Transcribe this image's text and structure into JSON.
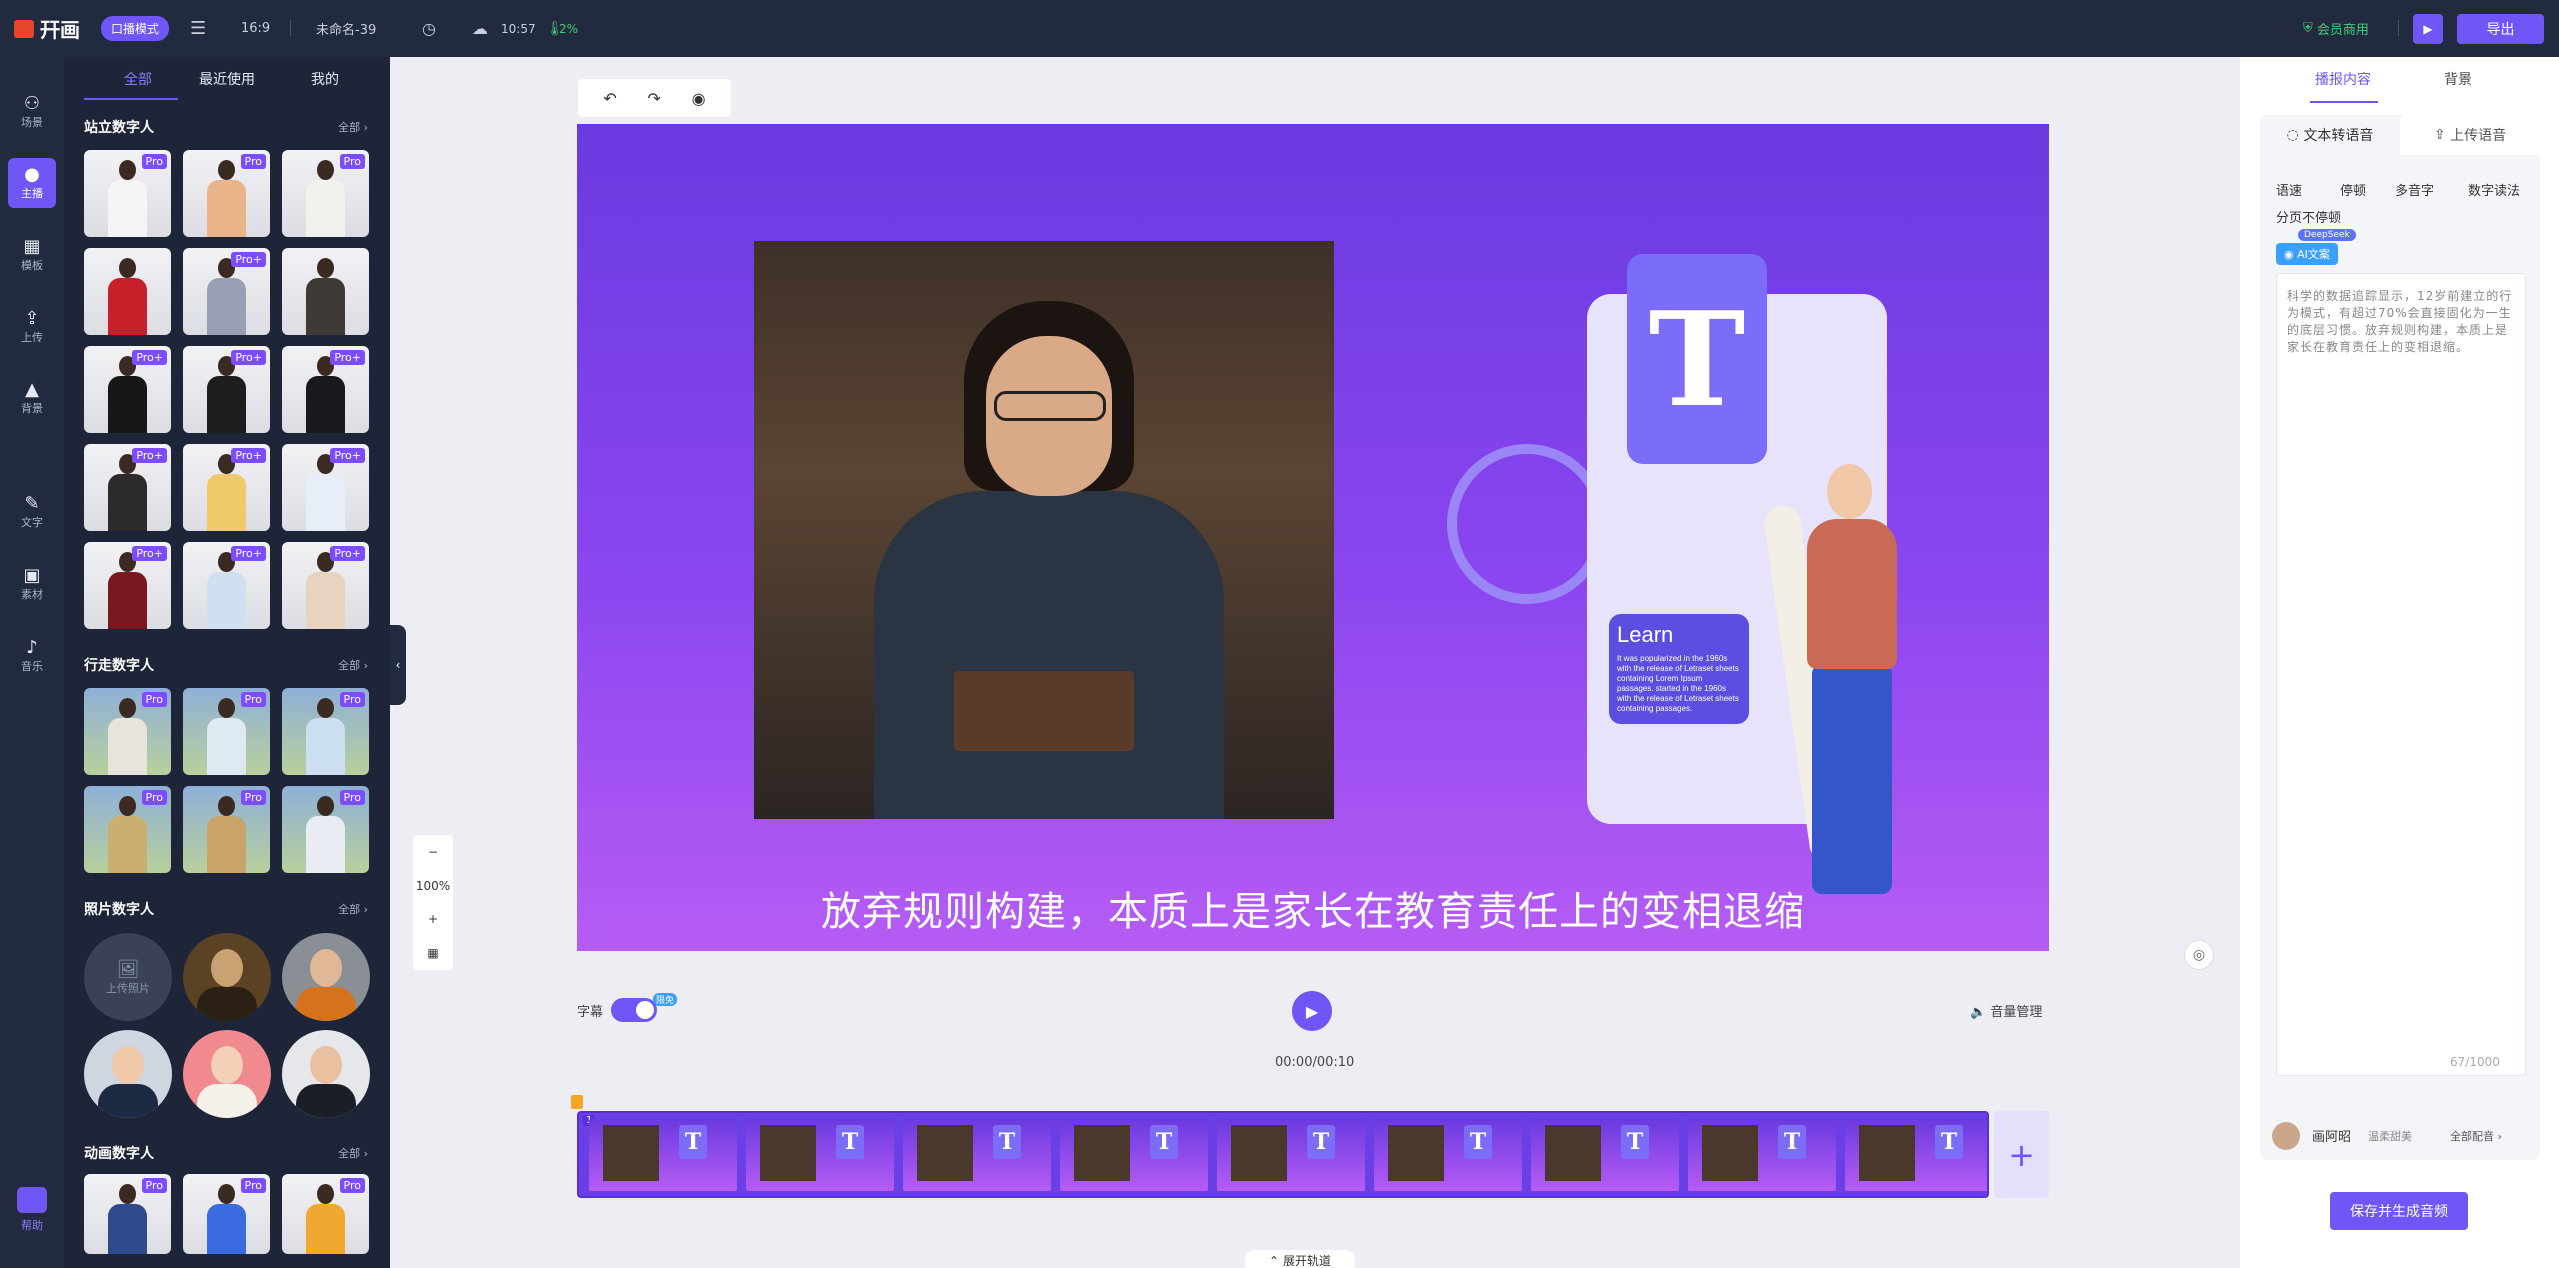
{
  "topbar": {
    "logo_text": "幵画",
    "mode_label": "口播模式",
    "ratio": "16:9",
    "project_name": "未命名-39",
    "save_time": "10:57",
    "progress": "2%",
    "vip_label": "会员商用",
    "export_label": "导出"
  },
  "nav": {
    "items": [
      {
        "label": "场景",
        "icon": "scene-icon"
      },
      {
        "label": "主播",
        "icon": "anchor-icon"
      },
      {
        "label": "模板",
        "icon": "template-icon"
      },
      {
        "label": "上传",
        "icon": "upload-icon"
      },
      {
        "label": "背景",
        "icon": "background-icon"
      },
      {
        "label": "文字",
        "icon": "text-icon"
      },
      {
        "label": "素材",
        "icon": "material-icon"
      },
      {
        "label": "音乐",
        "icon": "music-icon"
      }
    ],
    "help_label": "帮助"
  },
  "panel": {
    "tabs": [
      "全部",
      "最近使用",
      "我的"
    ],
    "all_label": "全部",
    "sections": {
      "standing": "站立数字人",
      "walking": "行走数字人",
      "photo": "照片数字人",
      "animated": "动画数字人"
    },
    "standing_badges": [
      "Pro",
      "Pro",
      "Pro",
      "",
      "Pro+",
      "",
      "Pro+",
      "Pro+",
      "Pro+",
      "Pro+",
      "Pro+",
      "Pro+",
      "Pro+",
      "Pro+",
      "Pro+"
    ],
    "walking_badges": [
      "Pro",
      "Pro",
      "Pro",
      "Pro",
      "Pro",
      "Pro"
    ],
    "animated_badges": [
      "Pro",
      "Pro",
      "Pro"
    ],
    "upload_photo_label": "上传照片"
  },
  "canvas": {
    "caption": "放弃规则构建，本质上是家长在教育责任上的变相退缩",
    "learn_title": "Learn",
    "learn_body": "It was popularized in the 1960s with the release of Letraset sheets containing Lorem Ipsum passages. started in the 1960s with the release of Letraset sheets containing passages.",
    "t_letter": "T"
  },
  "controls": {
    "subtitle_label": "字幕",
    "subtitle_badge": "限免",
    "volume_label": "音量管理",
    "time": "00:00/00:10",
    "zoom_level": "100%",
    "expand_label": "展开轨道",
    "clip_number": "1"
  },
  "right": {
    "tabs": [
      "播报内容",
      "背景"
    ],
    "tts_label": "文本转语音",
    "upload_audio_label": "上传语音",
    "options": [
      "语速",
      "停顿",
      "多音字",
      "数字读法"
    ],
    "no_pause_label": "分页不停顿",
    "deepseek_badge": "DeepSeek",
    "ai_label": "AI文案",
    "script_text": "科学的数据追踪显示，12岁前建立的行为模式，有超过70%会直接固化为一生的底层习惯。放弃规则构建，本质上是家长在教育责任上的变相退缩。",
    "char_count": "67/1000",
    "voice_name": "画阿昭",
    "voice_style": "温柔甜美",
    "all_voices_label": "全部配音",
    "save_label": "保存并生成音频"
  },
  "colors": {
    "accent": "#6e56f7",
    "topbar_bg": "#222a3f",
    "panel_bg": "#1f2538",
    "vip_green": "#3fcf78"
  }
}
